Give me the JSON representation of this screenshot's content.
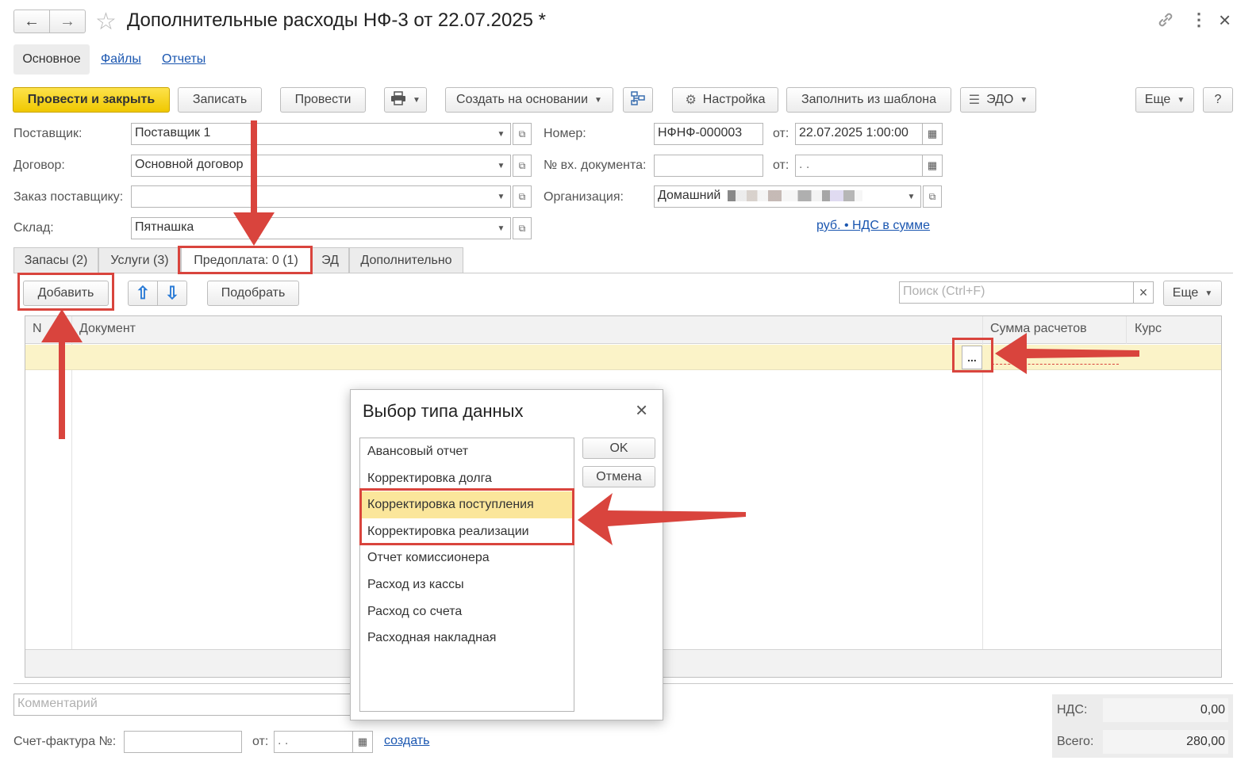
{
  "title": "Дополнительные расходы НФ-3 от 22.07.2025 *",
  "nav": {
    "back": "←",
    "forward": "→",
    "star": "☆"
  },
  "window_icons": {
    "link": "🔗",
    "more": "⋮",
    "close": "×"
  },
  "subtabs": [
    "Основное",
    "Файлы",
    "Отчеты"
  ],
  "toolbar": {
    "post_close": "Провести и закрыть",
    "save": "Записать",
    "post": "Провести",
    "create_based": "Создать на основании",
    "settings": "Настройка",
    "fill_template": "Заполнить из шаблона",
    "edo": "ЭДО",
    "more": "Еще",
    "help": "?"
  },
  "form": {
    "supplier_label": "Поставщик:",
    "supplier_value": "Поставщик 1",
    "contract_label": "Договор:",
    "contract_value": "Основной договор",
    "order_label": "Заказ поставщику:",
    "order_value": "",
    "warehouse_label": "Склад:",
    "warehouse_value": "Пятнашка",
    "number_label": "Номер:",
    "number_value": "НФНФ-000003",
    "from_label": "от:",
    "date_value": "22.07.2025  1:00:00",
    "in_doc_label": "№ вх. документа:",
    "in_doc_value": "",
    "in_date_value": " .  .",
    "org_label": "Организация:",
    "org_value": "Домашний",
    "currency_link": "руб. • НДС в сумме"
  },
  "doc_tabs": [
    "Запасы (2)",
    "Услуги (3)",
    "Предоплата: 0  (1)",
    "ЭД",
    "Дополнительно"
  ],
  "table_toolbar": {
    "add": "Добавить",
    "up": "⇧",
    "down": "⇩",
    "pick": "Подобрать",
    "search_placeholder": "Поиск (Ctrl+F)",
    "search_clear": "×",
    "more": "Еще"
  },
  "table": {
    "columns": [
      "N",
      "Документ",
      "Сумма расчетов",
      "Курс"
    ],
    "ellipsis": "..."
  },
  "dialog": {
    "title": "Выбор типа данных",
    "close": "×",
    "items": [
      "Авансовый отчет",
      "Корректировка долга",
      "Корректировка поступления",
      "Корректировка реализации",
      "Отчет комиссионера",
      "Расход из кассы",
      "Расход со счета",
      "Расходная накладная"
    ],
    "selected_index": 2,
    "ok": "OK",
    "cancel": "Отмена"
  },
  "footer": {
    "comment_placeholder": "Комментарий",
    "invoice_label": "Счет-фактура №:",
    "from_label": "от:",
    "invoice_date": " .  .",
    "create_link": "создать",
    "vat_label": "НДС:",
    "vat_value": "0,00",
    "total_label": "Всего:",
    "total_value": "280,00"
  },
  "colors": {
    "accent_yellow": "#f0c800",
    "highlight_red": "#d9443d",
    "row_highlight": "#fbf3c8",
    "link": "#1a56b0"
  }
}
